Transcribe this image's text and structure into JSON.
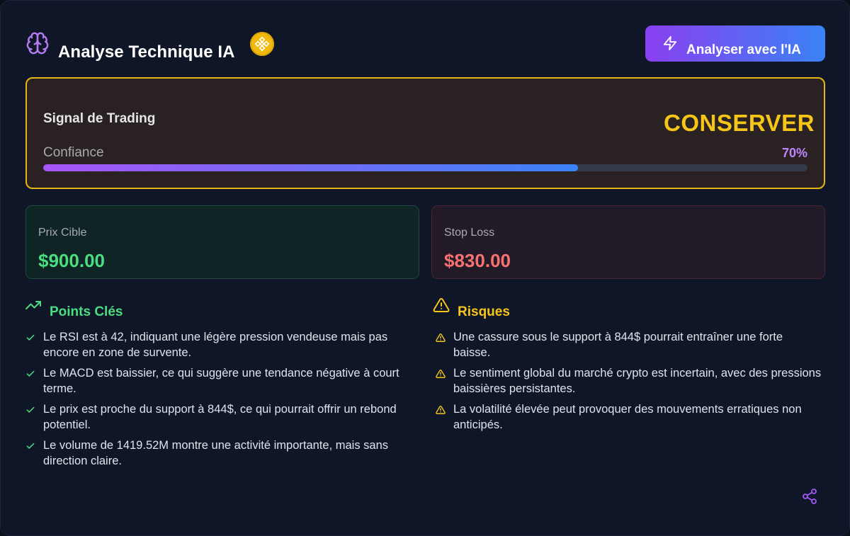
{
  "header": {
    "title": "Analyse Technique IA",
    "analyze_button": "Analyser avec l'IA",
    "brain_icon": "brain-icon",
    "coin_icon": "bnb-coin-icon"
  },
  "signal": {
    "title": "Signal de Trading",
    "value": "CONSERVER",
    "confidence_label": "Confiance",
    "confidence_text": "70%",
    "confidence": 0.7
  },
  "prices": {
    "target_label": "Prix Cible",
    "target_value": "$900.00",
    "stop_label": "Stop Loss",
    "stop_value": "$830.00"
  },
  "key_points": {
    "title": "Points Clés",
    "items": [
      "Le RSI est à 42, indiquant une légère pression vendeuse mais pas encore en zone de survente.",
      "Le MACD est baissier, ce qui suggère une tendance négative à court terme.",
      "Le prix est proche du support à 844$, ce qui pourrait offrir un rebond potentiel.",
      "Le volume de 1419.52M montre une activité importante, mais sans direction claire."
    ]
  },
  "risks": {
    "title": "Risques",
    "items": [
      "Une cassure sous le support à 844$ pourrait entraîner une forte baisse.",
      "Le sentiment global du marché crypto est incertain, avec des pressions baissières persistantes.",
      "La volatilité élevée peut provoquer des mouvements erratiques non anticipés."
    ]
  },
  "colors": {
    "accent_yellow": "#f5c518",
    "accent_green": "#4ade80",
    "accent_red": "#f87171",
    "accent_purple": "#a855f7",
    "accent_blue": "#3b82f6"
  }
}
